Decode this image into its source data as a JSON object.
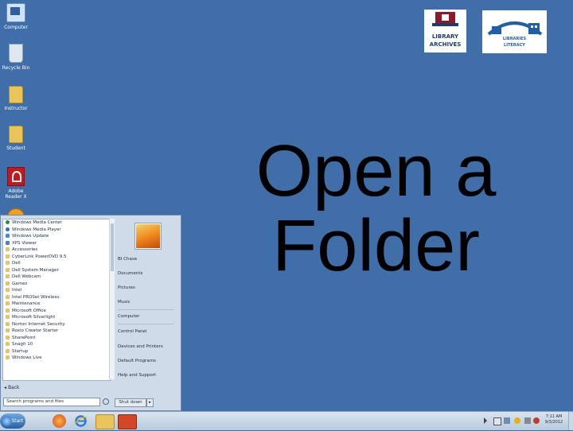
{
  "desktop": {
    "icons": [
      {
        "label": "Computer",
        "icon": "computer-icon"
      },
      {
        "label": "Recycle Bin",
        "icon": "recycle-bin-icon"
      },
      {
        "label": "Instructor",
        "icon": "folder-icon"
      },
      {
        "label": "Student",
        "icon": "folder-icon"
      },
      {
        "label": "Adobe Reader X",
        "icon": "pdf-icon"
      },
      {
        "label": "",
        "icon": "globe-icon"
      }
    ]
  },
  "logos": {
    "library": {
      "line1": "LIBRARY",
      "line2": "ARCHIVES"
    },
    "literacy": {
      "line1": "LIBRARIES",
      "line2": "LITERACY"
    }
  },
  "headline": {
    "line1": "Open a",
    "line2": "Folder"
  },
  "start_menu": {
    "programs": [
      "Windows Media Center",
      "Windows Media Player",
      "Windows Update",
      "XPS Viewer",
      "Accessories",
      "CyberLink PowerDVD 9.5",
      "Dell",
      "Dell System Manager",
      "Dell Webcam",
      "Games",
      "Intel",
      "Intel PROSet Wireless",
      "Maintenance",
      "Microsoft Office",
      "Microsoft Silverlight",
      "Norton Internet Security",
      "Roxio Creator Starter",
      "SharePoint",
      "Snagit 10",
      "Startup",
      "Windows Live"
    ],
    "back_label": "Back",
    "search_placeholder": "Search programs and files",
    "right_items": [
      "BI Chase",
      "Documents",
      "Pictures",
      "Music",
      "Computer",
      "Control Panel",
      "Devices and Printers",
      "Default Programs",
      "Help and Support"
    ],
    "shutdown_label": "Shut down",
    "shutdown_arrow": "▸"
  },
  "taskbar": {
    "start_label": "Start",
    "clock_time": "7:11 AM",
    "clock_date": "9/3/2012"
  },
  "colors": {
    "desktop_bg": "#3f6ea8",
    "accent": "#2a5f9e"
  }
}
